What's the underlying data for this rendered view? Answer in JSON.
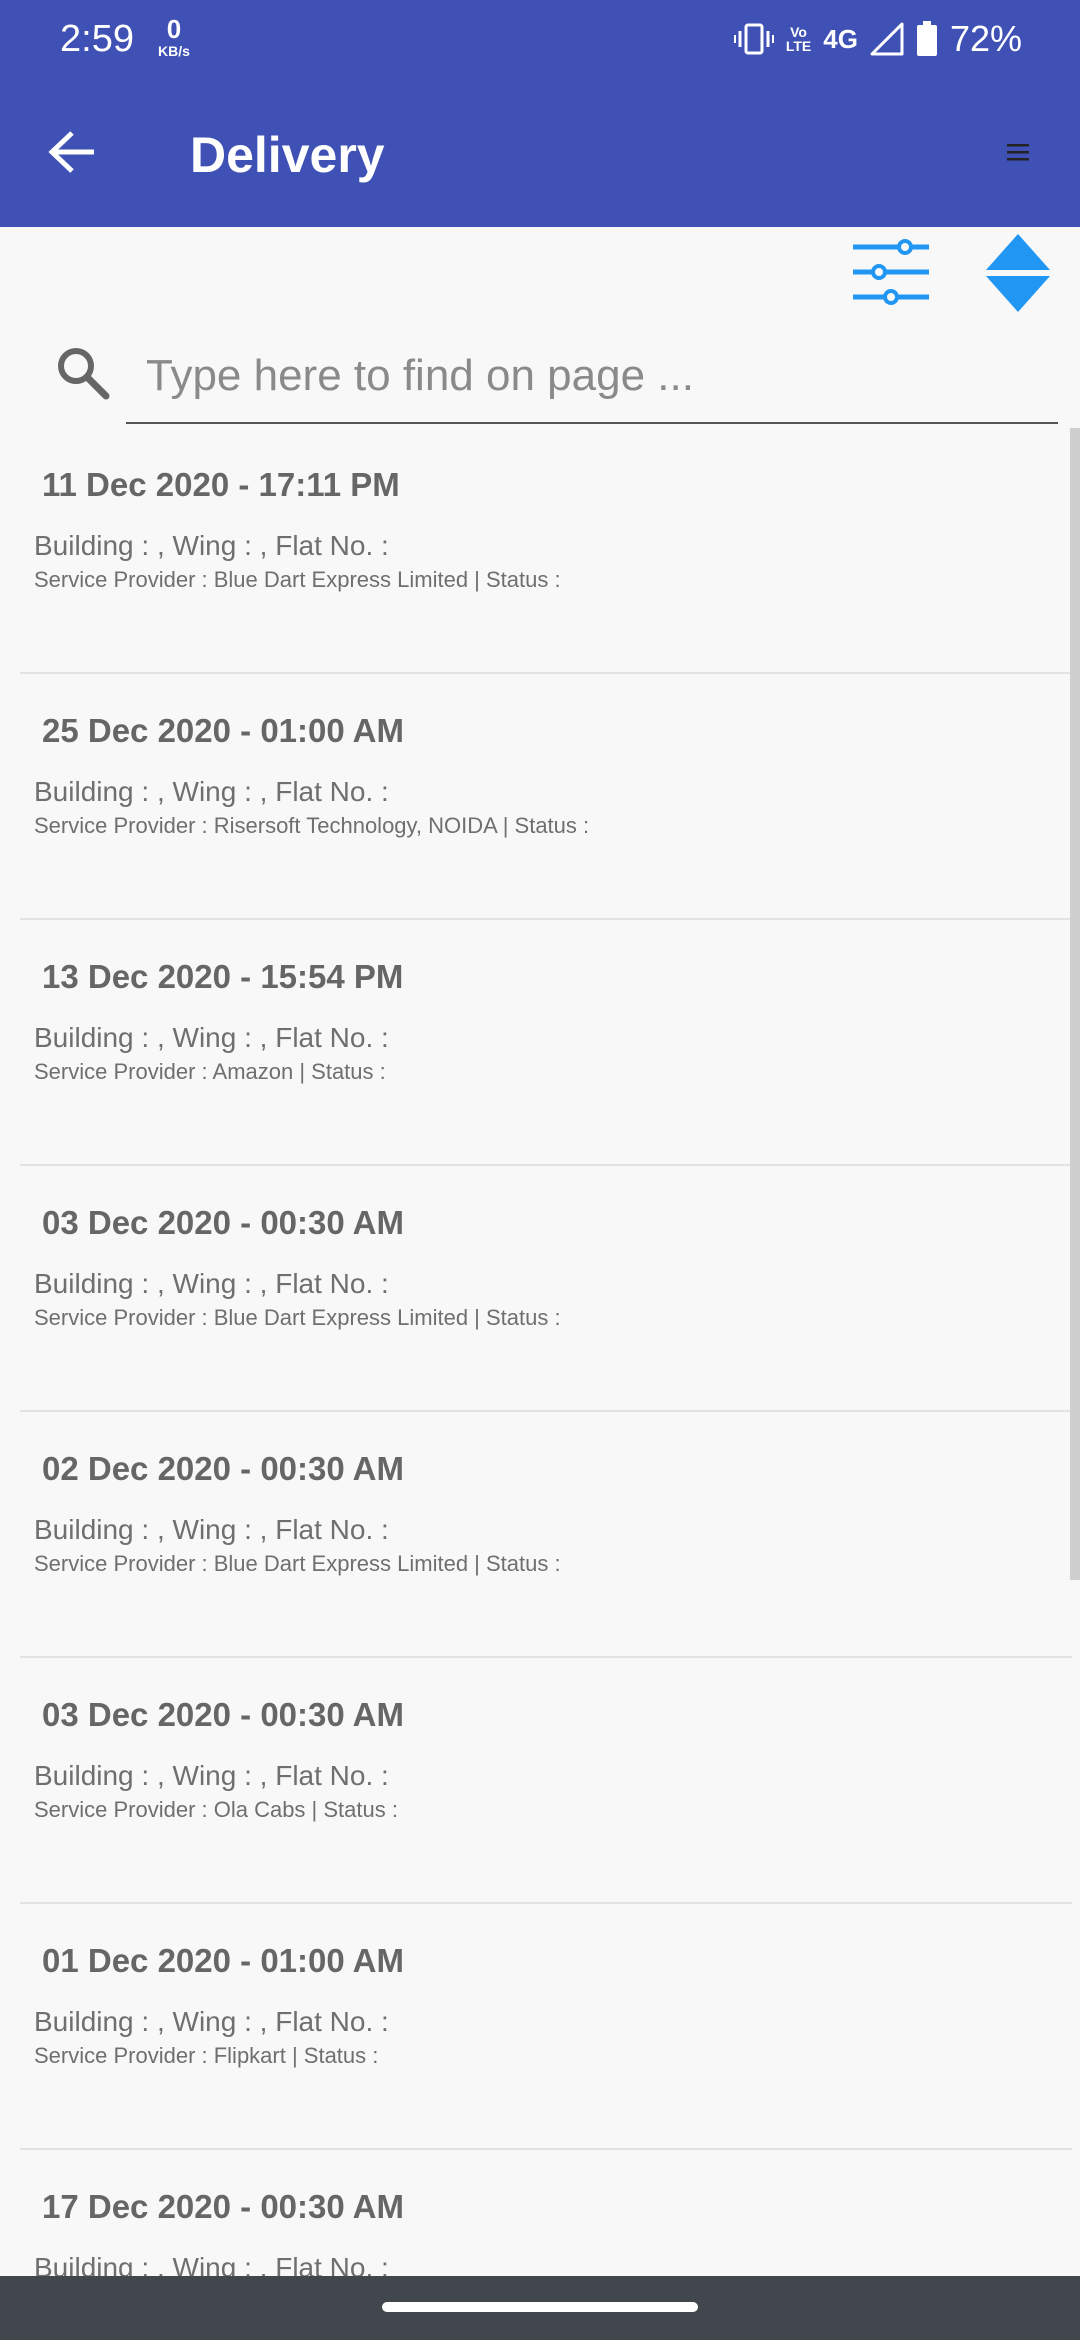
{
  "status_bar": {
    "time": "2:59",
    "net_speed_value": "0",
    "net_speed_unit": "KB/s",
    "volte_top": "Vo",
    "volte_bottom": "LTE",
    "network": "4G",
    "battery": "72%",
    "icons": [
      "vibrate-icon",
      "volte-icon",
      "signal-icon",
      "battery-icon"
    ]
  },
  "app_bar": {
    "title": "Delivery",
    "back_icon": "arrow-left-icon",
    "menu_icon": "hamburger-menu-icon",
    "background": "#3f51b5"
  },
  "toolbar": {
    "filter_icon": "sliders-icon",
    "sort_icon": "sort-up-down-icon",
    "accent": "#2196f3"
  },
  "search": {
    "placeholder": "Type here to find on page ...",
    "value": ""
  },
  "deliveries": [
    {
      "date": "11 Dec 2020 - 17:11 PM",
      "location": "Building : , Wing : , Flat No. :",
      "provider": "Service Provider : Blue Dart Express Limited | Status :"
    },
    {
      "date": "25 Dec 2020 - 01:00 AM",
      "location": "Building : , Wing : , Flat No. :",
      "provider": "Service Provider : Risersoft Technology, NOIDA | Status :"
    },
    {
      "date": "13 Dec 2020 - 15:54 PM",
      "location": "Building : , Wing : , Flat No. :",
      "provider": "Service Provider : Amazon | Status :"
    },
    {
      "date": "03 Dec 2020 - 00:30 AM",
      "location": "Building : , Wing : , Flat No. :",
      "provider": "Service Provider : Blue Dart Express Limited | Status :"
    },
    {
      "date": "02 Dec 2020 - 00:30 AM",
      "location": "Building : , Wing : , Flat No. :",
      "provider": "Service Provider : Blue Dart Express Limited | Status :"
    },
    {
      "date": "03 Dec 2020 - 00:30 AM",
      "location": "Building : , Wing : , Flat No. :",
      "provider": "Service Provider : Ola Cabs | Status :"
    },
    {
      "date": "01 Dec 2020 - 01:00 AM",
      "location": "Building : , Wing : , Flat No. :",
      "provider": "Service Provider : Flipkart | Status :"
    },
    {
      "date": "17 Dec 2020 - 00:30 AM",
      "location": "Building : , Wing : , Flat No. :",
      "provider": ""
    }
  ]
}
